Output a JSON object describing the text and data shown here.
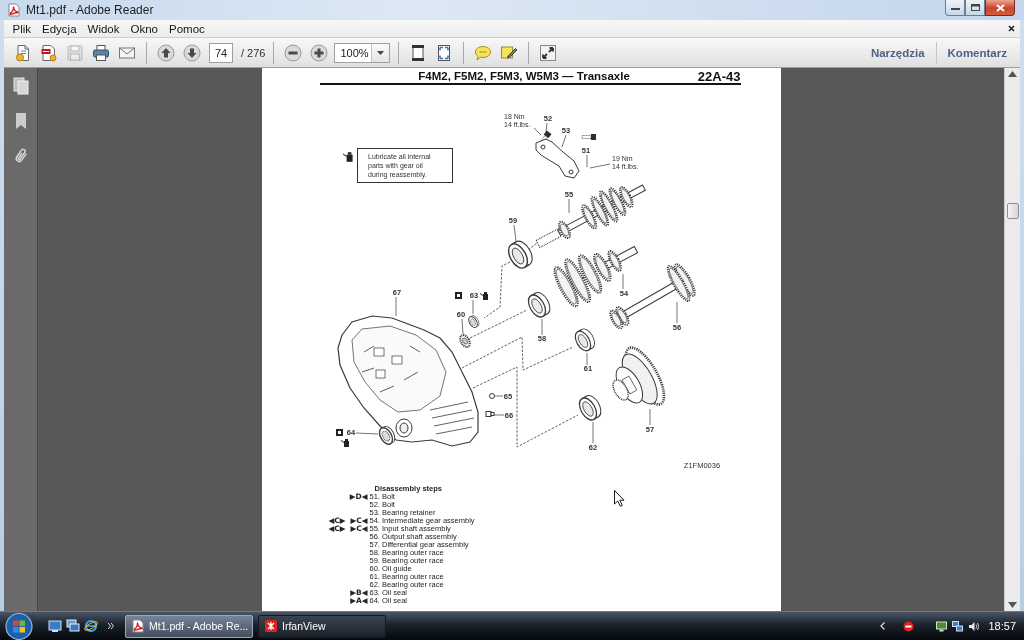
{
  "window": {
    "title": "Mt1.pdf - Adobe Reader"
  },
  "menu": [
    "Plik",
    "Edycja",
    "Widok",
    "Okno",
    "Pomoc"
  ],
  "toolbar": {
    "groups": [
      [
        {
          "kind": "create",
          "disabled": false
        },
        {
          "kind": "combine",
          "disabled": false
        },
        {
          "kind": "save",
          "disabled": true
        },
        {
          "kind": "print",
          "disabled": false
        },
        {
          "kind": "email",
          "disabled": false
        }
      ],
      [
        {
          "kind": "prev"
        },
        {
          "kind": "next"
        },
        {
          "kind": "page",
          "value": "74",
          "total": "/ 276"
        }
      ],
      [
        {
          "kind": "zoomout"
        },
        {
          "kind": "zoomin"
        },
        {
          "kind": "zoom",
          "value": "100%"
        }
      ],
      [
        {
          "kind": "fitpage"
        },
        {
          "kind": "fitwidth"
        }
      ],
      [
        {
          "kind": "comment"
        },
        {
          "kind": "highlight"
        }
      ],
      [
        {
          "kind": "expand"
        }
      ]
    ],
    "panels": [
      "Narzędzia",
      "Komentarz"
    ]
  },
  "sidebar": [
    {
      "kind": "pages"
    },
    {
      "kind": "bookmarks"
    },
    {
      "kind": "attachments"
    }
  ],
  "document": {
    "header": {
      "title": "F4M2, F5M2, F5M3, W5M3 — Transaxle",
      "page_number": "22A-43"
    },
    "note": "Lubricate all internal parts with gear oil during reassembly.",
    "parts": [
      {
        "kind": "bolt",
        "callout": "52",
        "torque": {
          "metric": "18 Nm",
          "imperial": "14 ft.lbs."
        }
      },
      {
        "kind": "retainer",
        "callout": "53"
      },
      {
        "kind": "bolt",
        "callout": "51",
        "torque": {
          "metric": "19 Nm",
          "imperial": "14 ft.lbs."
        }
      },
      {
        "kind": "shaft",
        "callout": "55"
      },
      {
        "kind": "race",
        "callout": "59"
      },
      {
        "kind": "gearset",
        "callout": "54"
      },
      {
        "kind": "outputshaft",
        "callout": "56"
      },
      {
        "kind": "housing",
        "callout": "67"
      },
      {
        "kind": "seal",
        "callout": "63"
      },
      {
        "kind": "guide",
        "callout": "60"
      },
      {
        "kind": "race",
        "callout": "58"
      },
      {
        "kind": "race",
        "callout": "61"
      },
      {
        "kind": "pin",
        "callout": "65"
      },
      {
        "kind": "plug",
        "callout": "66"
      },
      {
        "kind": "seal",
        "callout": "64"
      },
      {
        "kind": "race",
        "callout": "62"
      },
      {
        "kind": "differential",
        "callout": "57"
      }
    ],
    "figure_code": "Z1FM0036",
    "steps": {
      "title": "Disassembly steps",
      "items": [
        {
          "text": "51. Bolt",
          "marks": [
            "▶D◀"
          ]
        },
        {
          "text": "52. Bolt"
        },
        {
          "text": "53. Bearing retainer"
        },
        {
          "text": "54. Intermediate gear assembly",
          "marks": [
            "◀C▶",
            "▶C◀"
          ]
        },
        {
          "text": "55. Input shaft assembly",
          "marks": [
            "◀C▶",
            "▶C◀"
          ]
        },
        {
          "text": "56. Output shaft assembly"
        },
        {
          "text": "57. Differential gear assembly"
        },
        {
          "text": "58. Bearing outer race"
        },
        {
          "text": "59. Bearing outer race"
        },
        {
          "text": "60. Oil guide"
        },
        {
          "text": "61. Bearing outer race"
        },
        {
          "text": "62. Bearing outer race"
        },
        {
          "text": "63. Oil seal",
          "marks": [
            "▶B◀"
          ]
        },
        {
          "text": "64. Oil seal",
          "marks": [
            "▶A◀"
          ]
        }
      ]
    }
  },
  "taskbar": {
    "tasks": [
      {
        "label": "Mt1.pdf - Adobe Re...",
        "kind": "pdf",
        "selected": true
      },
      {
        "label": "IrfanView",
        "kind": "irfanview",
        "selected": false
      }
    ],
    "clock": "18:57"
  }
}
